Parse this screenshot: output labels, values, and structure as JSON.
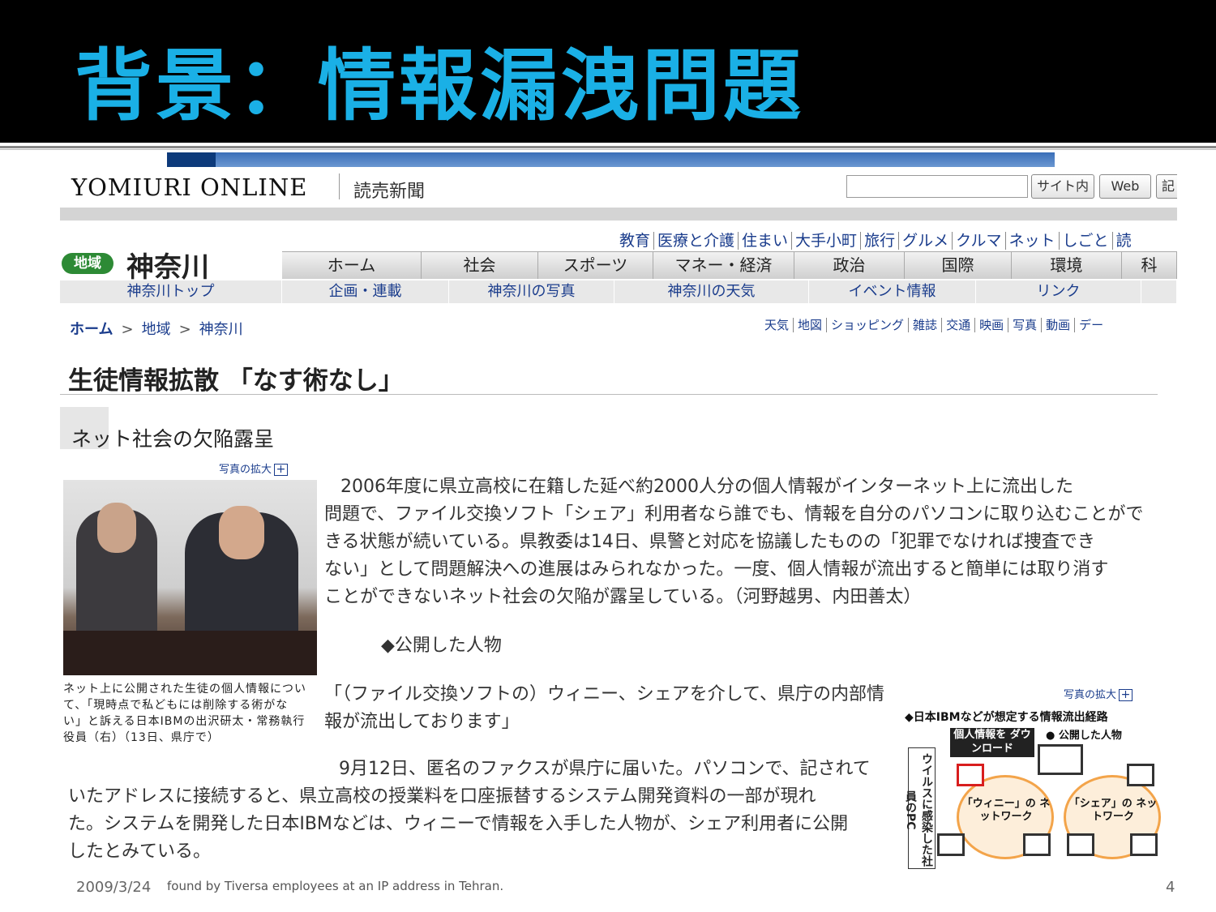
{
  "slide": {
    "title": "背景：情報漏洩問題",
    "footer_date": "2009/3/24",
    "page_number": "4",
    "bottom_scrap_text": "found by Tiversa employees at an IP address in Tehran.",
    "colors": {
      "title": "#1ab0e6",
      "title_bar": "#000000"
    }
  },
  "site": {
    "logo": "YOMIURI ONLINE",
    "logo_sub": "読売新聞",
    "search_placeholder": "",
    "search_buttons": [
      "サイト内",
      "Web",
      "記"
    ],
    "category_links": [
      "教育",
      "医療と介護",
      "住まい",
      "大手小町",
      "旅行",
      "グルメ",
      "クルマ",
      "ネット",
      "しごと",
      "読"
    ],
    "region_badge": "地域",
    "region_name": "神奈川",
    "main_nav": [
      "ホーム",
      "社会",
      "スポーツ",
      "マネー・経済",
      "政治",
      "国際",
      "環境",
      "科"
    ],
    "sub_nav": [
      "神奈川トップ",
      "企画・連載",
      "神奈川の写真",
      "神奈川の天気",
      "イベント情報",
      "リンク",
      ""
    ],
    "breadcrumb": [
      "ホーム",
      "地域",
      "神奈川"
    ],
    "breadcrumb_sep": ">",
    "util_links": [
      "天気",
      "地図",
      "ショッピング",
      "雑誌",
      "交通",
      "映画",
      "写真",
      "動画",
      "デー"
    ],
    "colors": {
      "link": "#1a3c8c",
      "badge": "#2d8a35"
    }
  },
  "article": {
    "headline": "生徒情報拡散 「なす術なし」",
    "subhead": "ネット社会の欠陥露呈",
    "photo_zoom_label": "写真の拡大",
    "photo_caption": "ネット上に公開された生徒の個人情報について、「現時点で私どもには削除する術がない」と訴える日本IBMの出沢研太・常務執行役員（右）（13日、県庁で）",
    "para1_lines": [
      "2006年度に県立高校に在籍した延べ約2000人分の個人情報がインターネット上に流出した",
      "問題で、ファイル交換ソフト「シェア」利用者なら誰でも、情報を自分のパソコンに取り込むことがで",
      "きる状態が続いている。県教委は14日、県警と対応を協議したものの「犯罪でなければ捜査でき",
      "ない」として問題解決への進展はみられなかった。一度、個人情報が流出すると簡単には取り消す",
      "ことができないネット社会の欠陥が露呈している。（河野越男、内田善太）"
    ],
    "section_marker": "◆公開した人物",
    "quote_lines": [
      "「（ファイル交換ソフトの）ウィニー、シェアを介して、県庁の内部情",
      "報が流出しております」"
    ],
    "para3_lines": [
      "9月12日、匿名のファクスが県庁に届いた。パソコンで、記されて",
      "いたアドレスに接続すると、県立高校の授業料を口座振替するシステム開発資料の一部が現れ",
      "た。システムを開発した日本IBMなどは、ウィニーで情報を入手した人物が、シェア利用者に公開",
      "したとみている。"
    ]
  },
  "diagram": {
    "zoom_label": "写真の拡大",
    "title": "◆日本IBMなどが想定する情報流出経路",
    "download_label": "個人情報を ダウンロード",
    "public_person": "公開した人物",
    "infected_label": "ウイルスに感染した社員のPC",
    "winny_network": "「ウィニー」の ネットワーク",
    "share_network": "「シェア」の ネットワーク"
  }
}
